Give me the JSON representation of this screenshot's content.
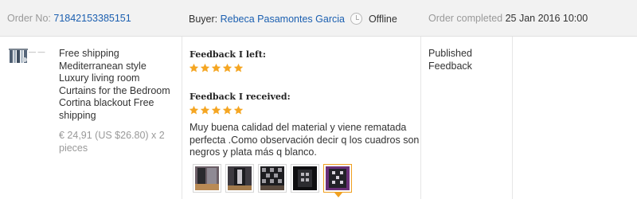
{
  "order": {
    "number_label": "Order No:",
    "number": "71842153385151",
    "buyer_label": "Buyer:",
    "buyer_name": "Rebeca Pasamontes Garcia",
    "buyer_status": "Offline",
    "completed_label": "Order completed",
    "completed_date": "25 Jan 2016 10:00"
  },
  "product": {
    "title": "Free shipping Mediterranean style Luxury living room Curtains for the Bedroom Cortina blackout Free shipping",
    "price": "€ 24,91 (US $26.80) x 2 pieces",
    "thumb_icon": "curtain-thumbnail-icon"
  },
  "feedback": {
    "left_heading": "Feedback I left:",
    "left_rating": 5,
    "received_heading": "Feedback I received:",
    "received_rating": 5,
    "received_text": "Muy buena calidad del material y viene rematada perfecta .Como observación decir q los cuadros son negros y plata más q blanco.",
    "photo_count": 5,
    "star_color": "#f5a623"
  },
  "status": {
    "text": "Published Feedback"
  }
}
